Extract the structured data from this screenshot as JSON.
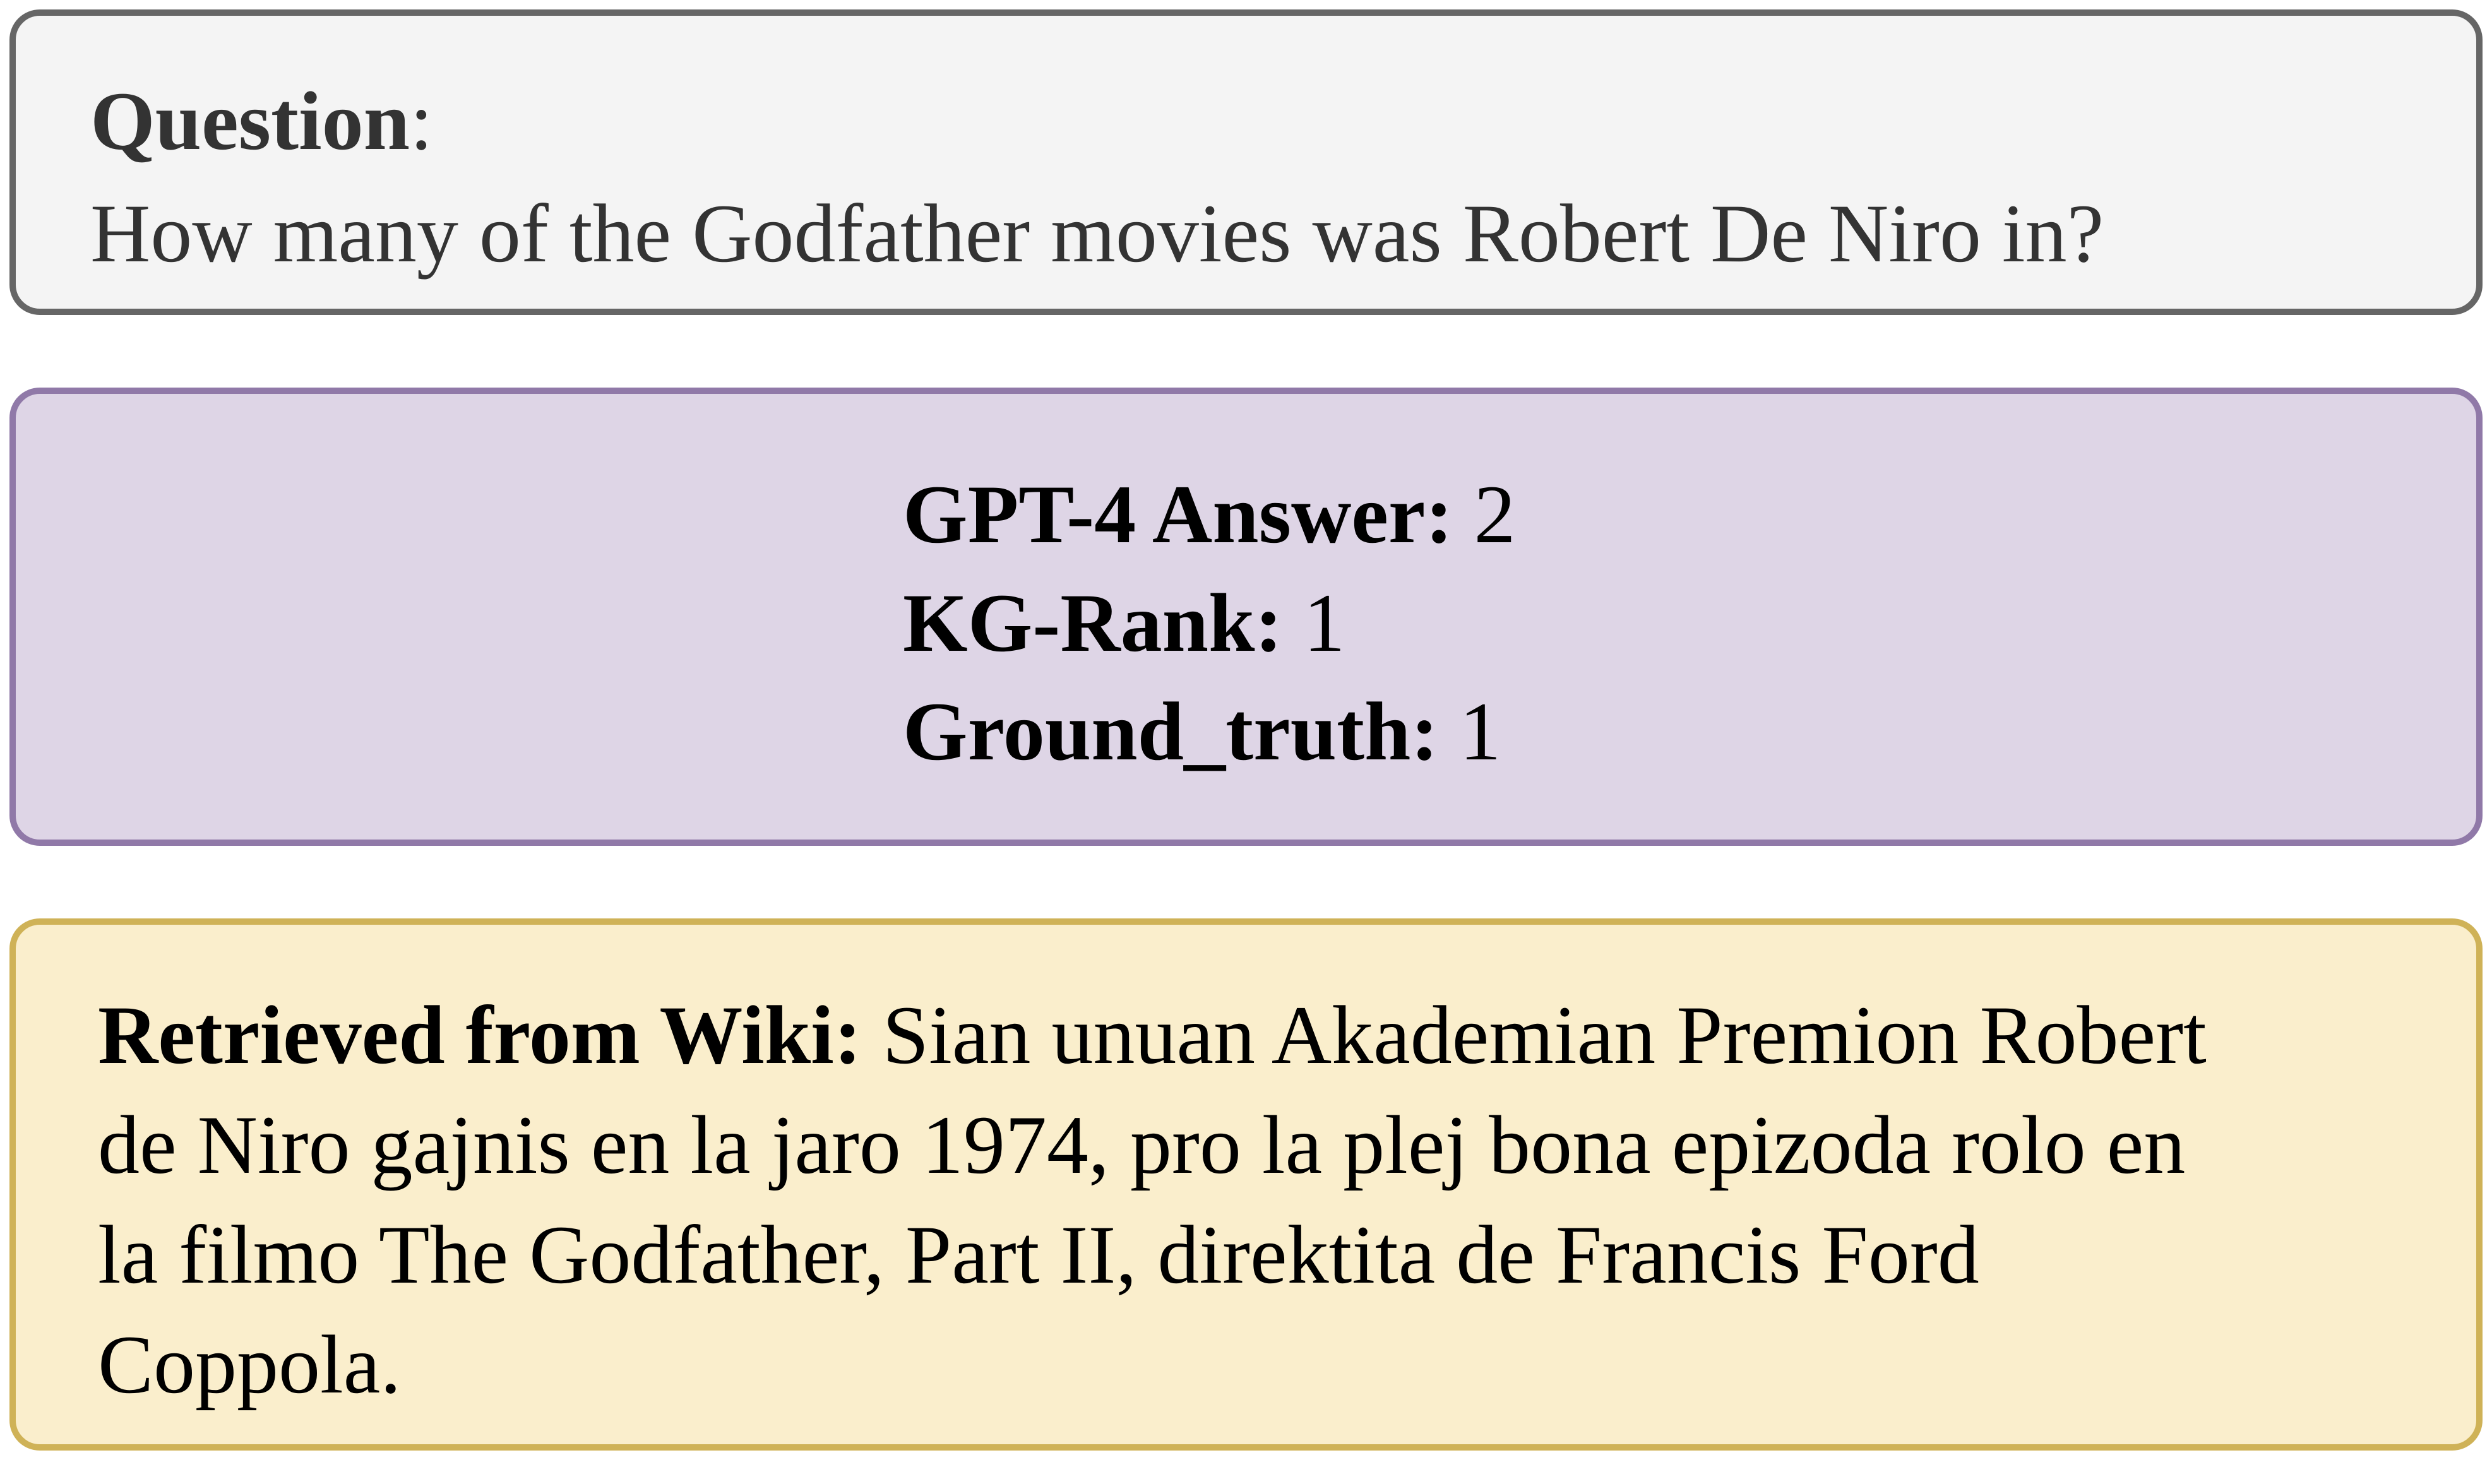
{
  "question": {
    "label": "Question",
    "colon": ":",
    "text": "How many of the Godfather movies was Robert De Niro in?"
  },
  "answers": [
    {
      "label": "GPT-4 Answer:",
      "value": "2"
    },
    {
      "label": "KG-Rank:",
      "value": "1"
    },
    {
      "label": "Ground_truth:",
      "value": "1"
    }
  ],
  "wiki": {
    "label": "Retrieved from Wiki:",
    "lines": [
      "Sian unuan Akademian Premion Robert",
      "de Niro gajnis en la jaro 1974, pro la plej bona epizoda rolo en",
      "la filmo The Godfather, Part II, direktita de Francis Ford",
      "Coppola."
    ]
  },
  "colors": {
    "question_bg": "#f4f4f4",
    "question_border": "#666666",
    "answer_bg": "#ded5e6",
    "answer_border": "#9079a8",
    "wiki_bg": "#faeecc",
    "wiki_border": "#cfb257"
  }
}
